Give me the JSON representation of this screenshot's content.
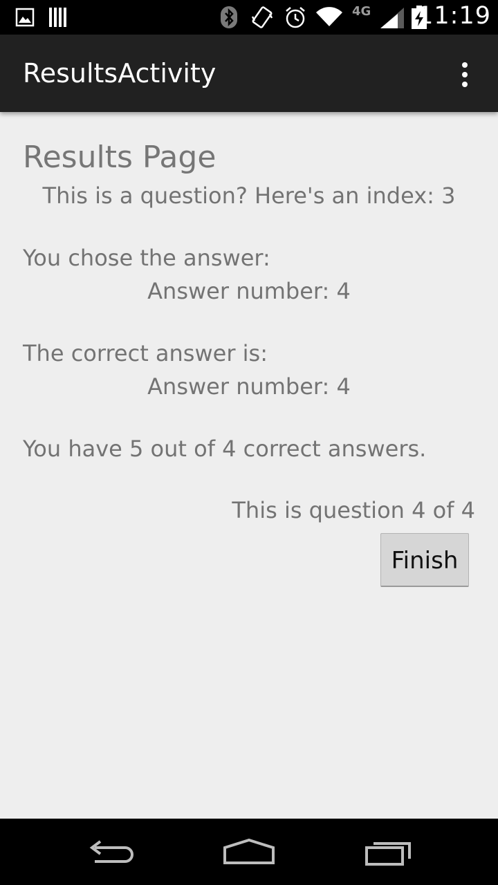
{
  "status_bar": {
    "time": "11:19",
    "network_label": "4G",
    "icons": [
      "image-notification-icon",
      "barcode-notification-icon",
      "bluetooth-icon",
      "vibrate-icon",
      "alarm-icon",
      "wifi-icon",
      "signal-icon",
      "battery-charging-icon"
    ]
  },
  "action_bar": {
    "title": "ResultsActivity",
    "overflow_icon": "overflow-menu-icon"
  },
  "content": {
    "title": "Results Page",
    "question": "This is a question? Here's an index: 3",
    "chose_label": "You chose the answer:",
    "chose_value": "Answer number: 4",
    "correct_label": "The correct answer is:",
    "correct_value": "Answer number: 4",
    "score": "You have 5 out of 4 correct answers.",
    "progress": "This is question 4 of 4",
    "finish_label": "Finish"
  },
  "nav_bar": {
    "icons": [
      "back-icon",
      "home-icon",
      "recents-icon"
    ]
  },
  "colors": {
    "status_bar": "#000000",
    "action_bar": "#212121",
    "background": "#eeeeee",
    "text": "#737373",
    "button": "#d6d6d6"
  }
}
